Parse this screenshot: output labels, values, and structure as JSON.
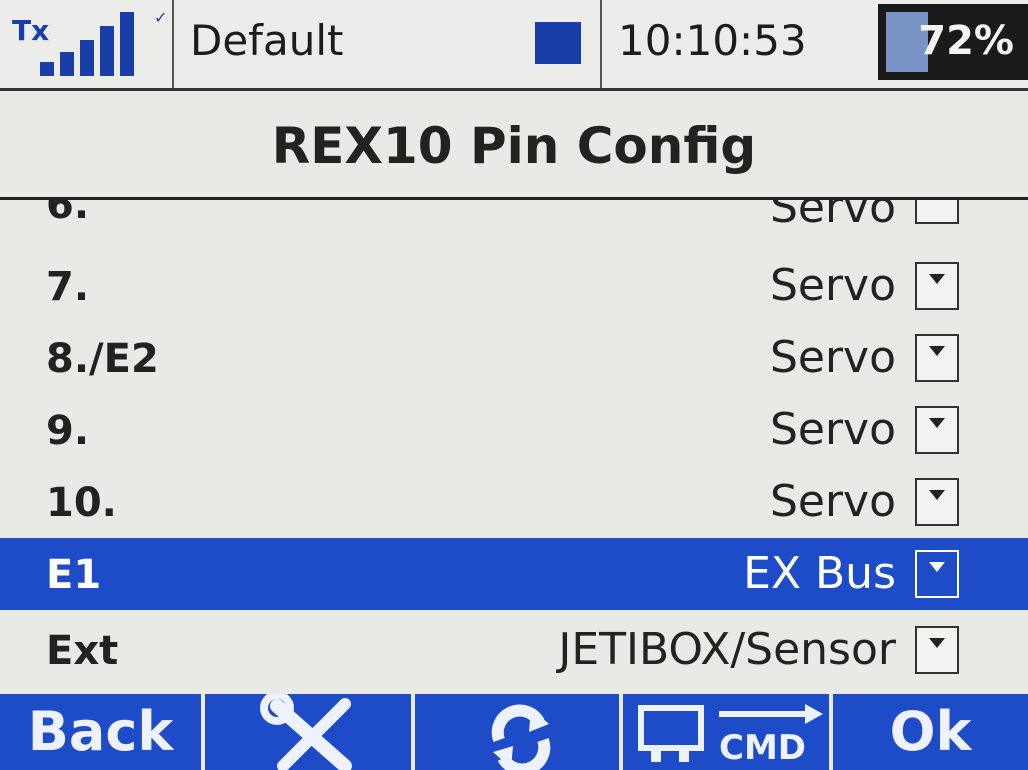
{
  "status_bar": {
    "tx_label": "Tx",
    "signal_bars": 5,
    "model_name": "Default",
    "time": "10:10:53",
    "battery_percent": "72%",
    "accent_color": "#1e4bc8"
  },
  "screen": {
    "title": "REX10 Pin Config"
  },
  "rows": [
    {
      "label": "6.",
      "value": "Servo",
      "partial": true
    },
    {
      "label": "7.",
      "value": "Servo"
    },
    {
      "label": "8./E2",
      "value": "Servo"
    },
    {
      "label": "9.",
      "value": "Servo"
    },
    {
      "label": "10.",
      "value": "Servo"
    },
    {
      "label": "E1",
      "value": "EX Bus",
      "selected": true
    },
    {
      "label": "Ext",
      "value": "JETIBOX/Sensor"
    }
  ],
  "bottom_bar": {
    "back_label": "Back",
    "settings_icon": "wrench-screwdriver-icon",
    "refresh_icon": "refresh-icon",
    "cmd_icon": "cmd-icon",
    "cmd_label": "CMD",
    "ok_label": "Ok"
  }
}
